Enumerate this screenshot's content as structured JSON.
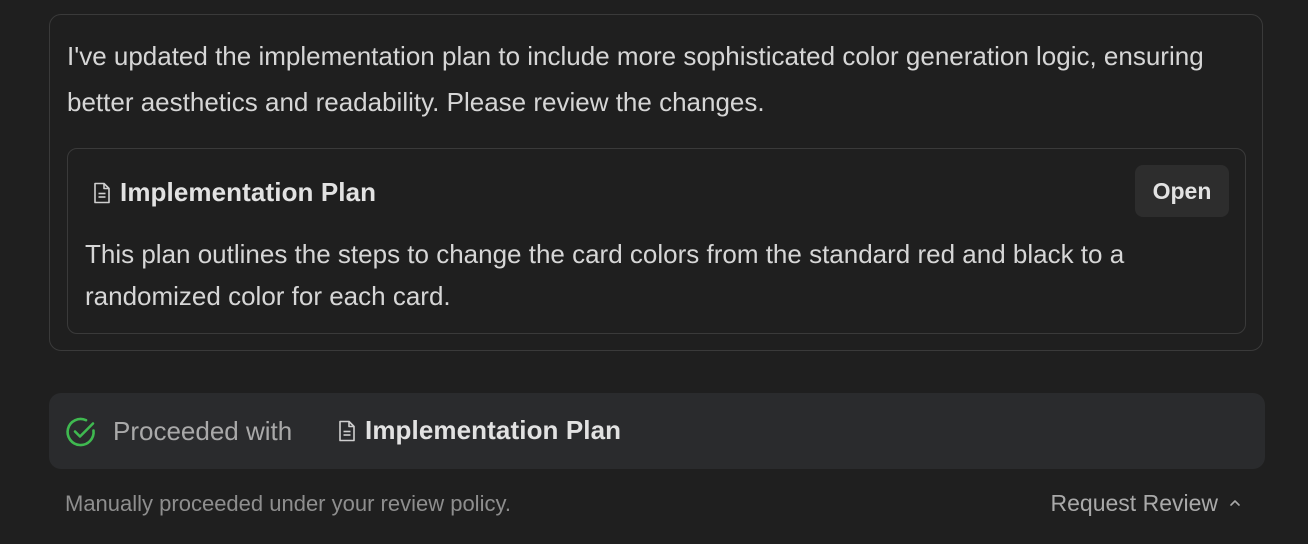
{
  "message": {
    "text": "I've updated the implementation plan to include more sophisticated color generation logic, ensuring better aesthetics and readability. Please review the changes."
  },
  "artifact": {
    "icon": "document-icon",
    "title": "Implementation Plan",
    "open_label": "Open",
    "description": "This plan outlines the steps to change the card colors from the standard red and black to a randomized color for each card."
  },
  "status": {
    "icon": "check-circle-icon",
    "label": "Proceeded with",
    "artifact_icon": "document-icon",
    "artifact_title": "Implementation Plan"
  },
  "footer": {
    "note": "Manually proceeded under your review policy.",
    "request_review_label": "Request Review",
    "chevron_icon": "chevron-up-icon"
  },
  "colors": {
    "background": "#1f1f1f",
    "card_border": "#3a3a3a",
    "status_bg": "#2a2b2d",
    "success": "#3fb950",
    "text": "#d6d6d6",
    "muted": "#8e8e8e"
  }
}
